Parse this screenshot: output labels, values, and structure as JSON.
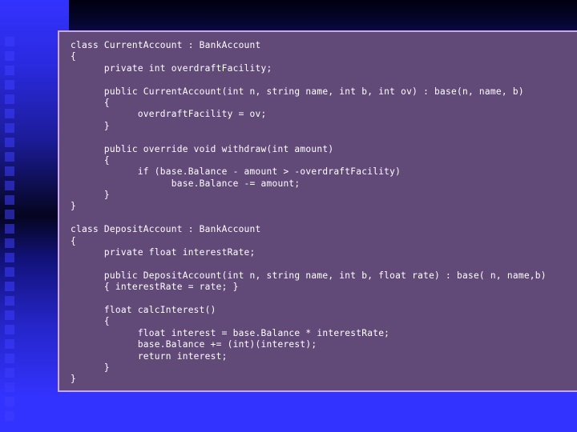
{
  "slide": {
    "code_lines": [
      "class CurrentAccount : BankAccount",
      "{",
      "      private int overdraftFacility;",
      "",
      "      public CurrentAccount(int n, string name, int b, int ov) : base(n, name, b)",
      "      {",
      "            overdraftFacility = ov;",
      "      }",
      "",
      "      public override void withdraw(int amount)",
      "      {",
      "            if (base.Balance - amount > -overdraftFacility)",
      "                  base.Balance -= amount;",
      "      }",
      "}",
      "",
      "class DepositAccount : BankAccount",
      "{",
      "      private float interestRate;",
      "",
      "      public DepositAccount(int n, string name, int b, float rate) : base( n, name,b)",
      "      { interestRate = rate; }",
      "",
      "      float calcInterest()",
      "      {",
      "            float interest = base.Balance * interestRate;",
      "            base.Balance += (int)(interest);",
      "            return interest;",
      "      }",
      "}"
    ]
  },
  "colors": {
    "background_blue": "#3333ff",
    "code_box_fill": "#614a78",
    "code_box_border": "#c8a8f0",
    "code_text": "#ffffff"
  }
}
